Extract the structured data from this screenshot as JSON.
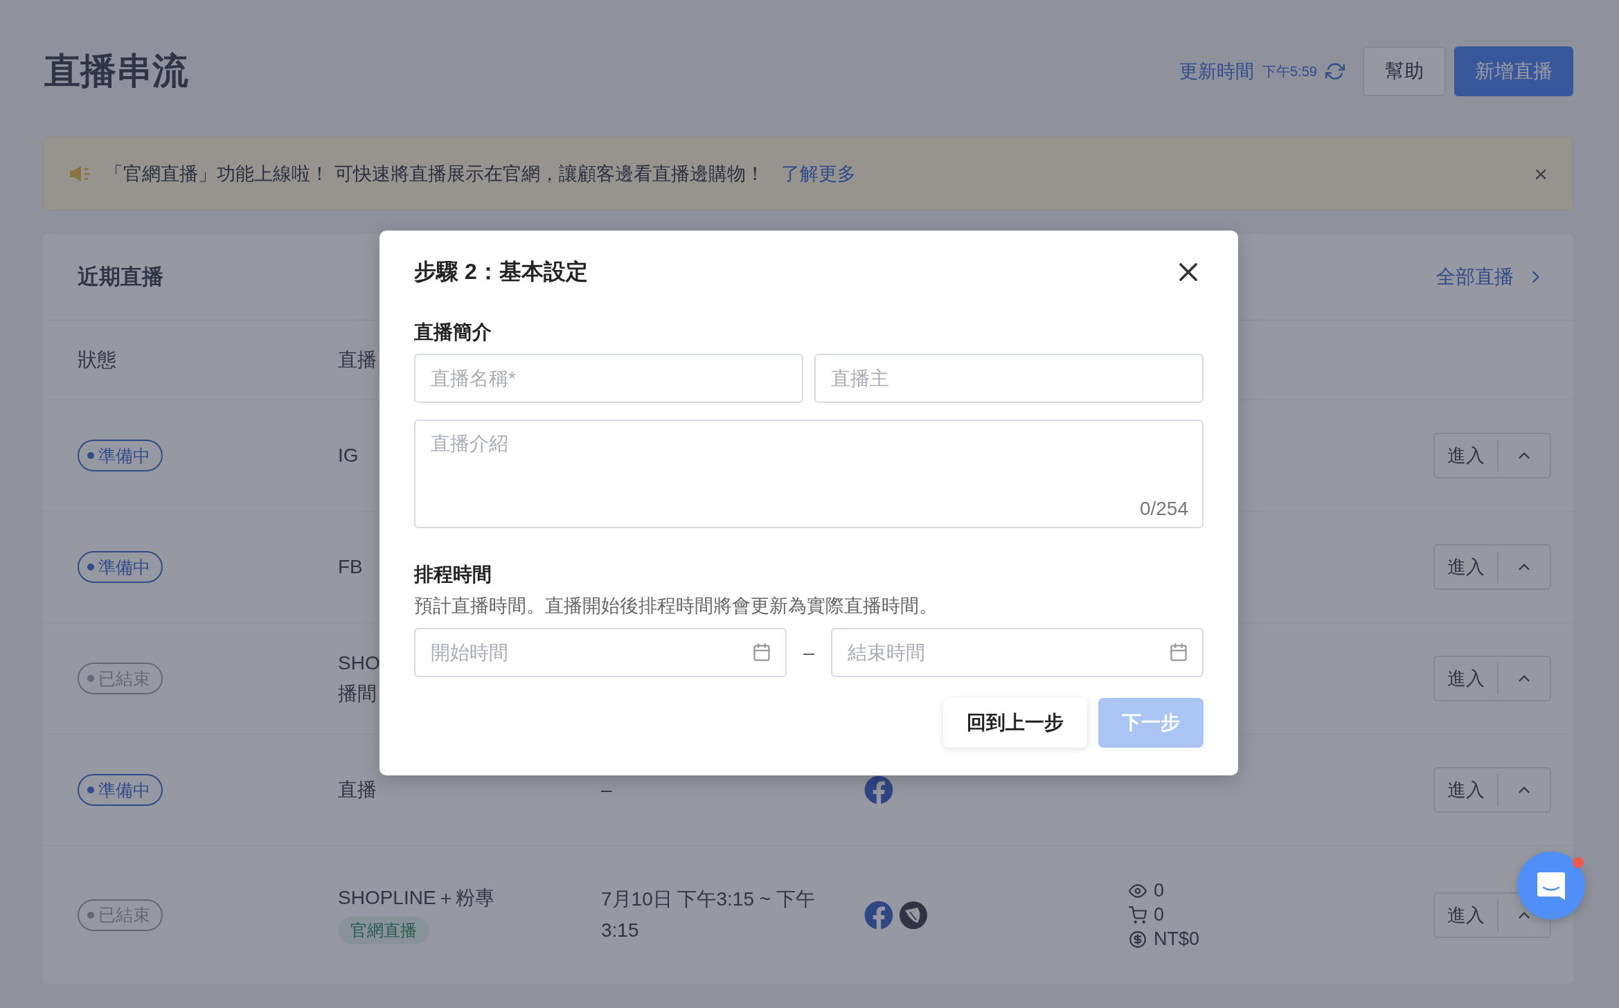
{
  "page": {
    "title": "直播串流",
    "update_label": "更新時間",
    "update_time": "下午5:59",
    "help_button": "幫助",
    "new_button": "新增直播"
  },
  "banner": {
    "text": "「官網直播」功能上線啦！ 可快速將直播展示在官網，讓顧客邊看直播邊購物！",
    "link": "了解更多",
    "close": "×"
  },
  "recent": {
    "title": "近期直播",
    "all_link": "全部直播",
    "columns": [
      "狀態",
      "直播"
    ],
    "rows": [
      {
        "status": "準備中",
        "kind": "preparing",
        "name_lines": [
          "IG"
        ],
        "action": "進入"
      },
      {
        "status": "準備中",
        "kind": "preparing",
        "name_lines": [
          "FB"
        ],
        "action": "進入"
      },
      {
        "status": "已結束",
        "kind": "ended",
        "name_lines": [
          "SHO",
          "播間"
        ],
        "action": "進入"
      },
      {
        "status": "準備中",
        "kind": "preparing",
        "name_lines": [
          "直播"
        ],
        "time": "–",
        "channels": [
          {
            "kind": "facebook"
          }
        ],
        "action": "進入"
      },
      {
        "status": "已結束",
        "kind": "ended",
        "name_lines": [
          "SHOPLINE＋粉專"
        ],
        "tag": "官網直播",
        "time": "7月10日 下午3:15 ~ 下午3:15",
        "channels": [
          {
            "kind": "facebook"
          },
          {
            "kind": "shopline"
          }
        ],
        "stats": {
          "views": "0",
          "carts": "0",
          "sales": "NT$0"
        },
        "action": "進入"
      }
    ]
  },
  "modal": {
    "title": "步驟 2：基本設定",
    "section_intro": "直播簡介",
    "name_placeholder": "直播名稱*",
    "host_placeholder": "直播主",
    "desc_placeholder": "直播介紹",
    "counter": "0/254",
    "section_schedule": "排程時間",
    "schedule_hint": "預計直播時間。直播開始後排程時間將會更新為實際直播時間。",
    "start_placeholder": "開始時間",
    "separator": "–",
    "end_placeholder": "結束時間",
    "back_button": "回到上一步",
    "next_button": {
      "label": "下一步",
      "disabled": true
    }
  },
  "chat": {
    "unread": true
  }
}
